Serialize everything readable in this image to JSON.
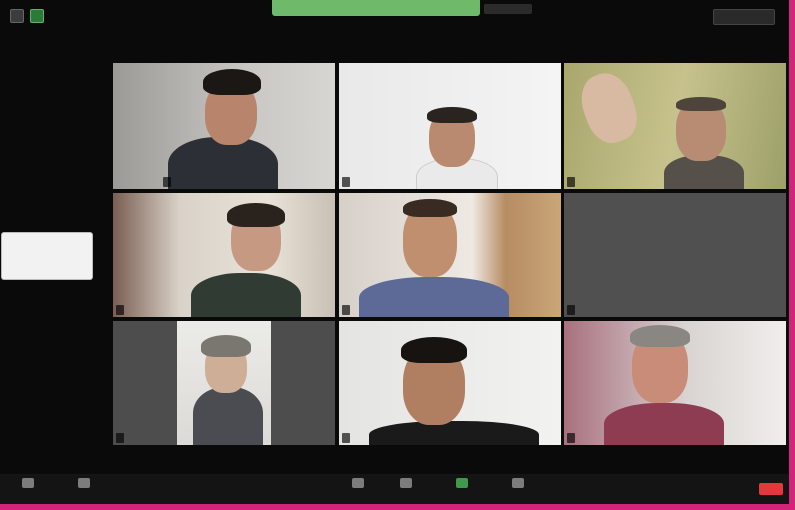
{
  "window": {
    "view_label": "",
    "talking_label": "",
    "banner_extra": ""
  },
  "self_view": {
    "label": ""
  },
  "participants": [
    {
      "name": ""
    },
    {
      "name": ""
    },
    {
      "name": ""
    },
    {
      "name": ""
    },
    {
      "name": ""
    },
    {
      "name": ""
    },
    {
      "name": ""
    },
    {
      "name": ""
    },
    {
      "name": ""
    }
  ],
  "toolbar": {
    "items": [
      {
        "label": "",
        "icon": "microphone-icon"
      },
      {
        "label": "",
        "icon": "video-camera-icon"
      },
      {
        "label": "",
        "icon": "participants-icon"
      },
      {
        "label": "",
        "icon": "chat-icon"
      },
      {
        "label": "",
        "icon": "share-screen-icon"
      },
      {
        "label": "",
        "icon": "reactions-icon"
      }
    ],
    "end_label": ""
  },
  "colors": {
    "accent_border": "#d4237a",
    "speaking_green": "#6fb96a",
    "end_red": "#e23a3a"
  }
}
